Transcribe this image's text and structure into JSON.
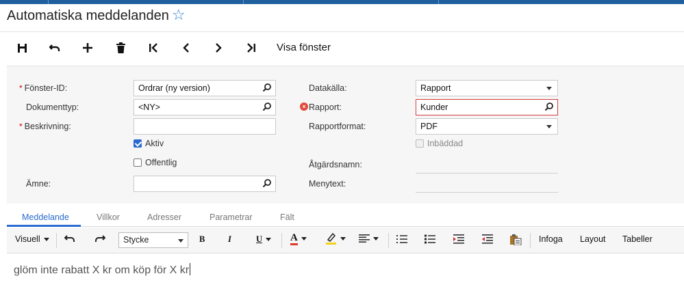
{
  "page": {
    "title": "Automatiska meddelanden"
  },
  "toolbar": {
    "window_label": "Visa fönster"
  },
  "form": {
    "window_id": {
      "label": "Fönster-ID:",
      "value": "Ordrar (ny version)"
    },
    "doc_type": {
      "label": "Dokumenttyp:",
      "value": "<NY>"
    },
    "description": {
      "label": "Beskrivning:",
      "value": ""
    },
    "active": {
      "label": "Aktiv",
      "checked": true
    },
    "public": {
      "label": "Offentlig",
      "checked": false
    },
    "subject": {
      "label": "Ämne:",
      "value": ""
    },
    "datasource": {
      "label": "Datakälla:",
      "value": "Rapport"
    },
    "report": {
      "label": "Rapport:",
      "value": "Kunder"
    },
    "report_format": {
      "label": "Rapportformat:",
      "value": "PDF"
    },
    "embedded": {
      "label": "Inbäddad",
      "checked": false
    },
    "action_name": {
      "label": "Åtgärdsnamn:",
      "value": ""
    },
    "menu_text": {
      "label": "Menytext:",
      "value": ""
    }
  },
  "tabs": [
    "Meddelande",
    "Villkor",
    "Adresser",
    "Parametrar",
    "Fält"
  ],
  "editor": {
    "mode": "Visuell",
    "paragraph_style": "Stycke",
    "bold": "B",
    "italic": "I",
    "underline": "U",
    "font_color": "A",
    "insert": "Infoga",
    "layout": "Layout",
    "tables": "Tabeller",
    "content": "glöm inte rabatt X kr om köp för X kr"
  },
  "colors": {
    "accent": "#2a6ad1",
    "topbar": "#1f5f9e",
    "error": "#d63b3b",
    "star": "#2e7ed6"
  }
}
